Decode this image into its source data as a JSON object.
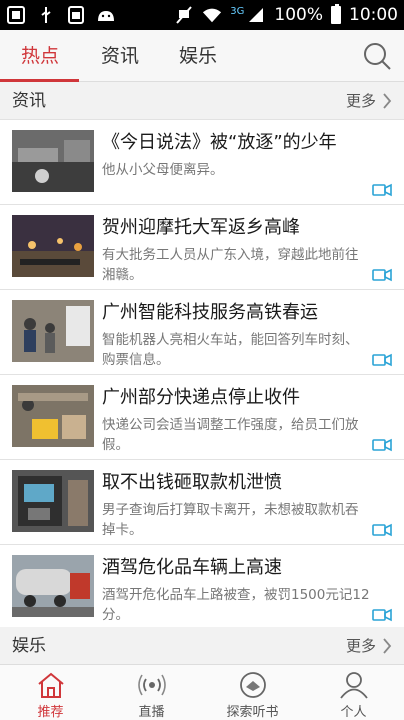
{
  "status_bar": {
    "network": "3G",
    "battery": "100%",
    "time": "10:00"
  },
  "tabs": [
    {
      "label": "热点",
      "active": true
    },
    {
      "label": "资讯",
      "active": false
    },
    {
      "label": "娱乐",
      "active": false
    }
  ],
  "sections": {
    "news": {
      "title": "资讯",
      "more": "更多"
    },
    "entertainment": {
      "title": "娱乐",
      "more": "更多"
    }
  },
  "news": [
    {
      "title": "《今日说法》被“放逐”的少年",
      "desc": "他从小父母便离异。",
      "has_video": true
    },
    {
      "title": "贺州迎摩托大军返乡高峰",
      "desc": "有大批务工人员从广东入境，穿越此地前往湘赣。",
      "has_video": true
    },
    {
      "title": "广州智能科技服务高铁春运",
      "desc": "智能机器人亮相火车站，能回答列车时刻、购票信息。",
      "has_video": true
    },
    {
      "title": "广州部分快递点停止收件",
      "desc": "快递公司会适当调整工作强度，给员工们放假。",
      "has_video": true
    },
    {
      "title": "取不出钱砸取款机泄愤",
      "desc": "男子查询后打算取卡离开，未想被取款机吞掉卡。",
      "has_video": true
    },
    {
      "title": "酒驾危化品车辆上高速",
      "desc": "酒驾开危化品车上路被查，被罚1500元记12分。",
      "has_video": true
    }
  ],
  "bottom_nav": [
    {
      "label": "推荐",
      "icon": "home-icon",
      "active": true
    },
    {
      "label": "直播",
      "icon": "broadcast-icon",
      "active": false
    },
    {
      "label": "探索听书",
      "icon": "audiobook-icon",
      "active": false
    },
    {
      "label": "个人",
      "icon": "person-icon",
      "active": false
    }
  ],
  "colors": {
    "accent": "#d0363a",
    "video_icon": "#2aa3d6"
  }
}
